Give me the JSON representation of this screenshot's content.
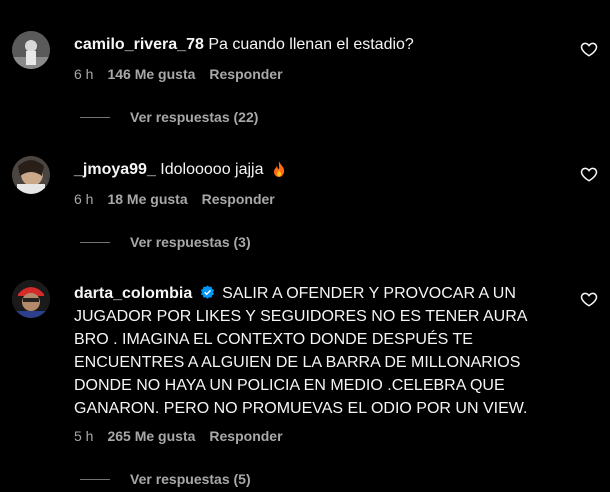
{
  "comments": [
    {
      "username": "camilo_rivera_78",
      "text": "Pa cuando llenan el estadio?",
      "time": "6 h",
      "likes": "146 Me gusta",
      "reply": "Responder",
      "view_replies": "Ver respuestas (22)"
    },
    {
      "username": "_jmoya99_",
      "text": "Idolooooo jajja",
      "time": "6 h",
      "likes": "18 Me gusta",
      "reply": "Responder",
      "view_replies": "Ver respuestas (3)"
    },
    {
      "username": "darta_colombia",
      "verified": true,
      "text": "SALIR A OFENDER Y PROVOCAR A UN JUGADOR POR LIKES Y SEGUIDORES NO ES TENER AURA BRO . IMAGINA EL CONTEXTO DONDE DESPUÉS TE ENCUENTRES A ALGUIEN DE LA BARRA DE MILLONARIOS DONDE NO HAYA UN POLICIA EN MEDIO .CELEBRA QUE GANARON. PERO NO PROMUEVAS EL ODIO POR UN VIEW.",
      "time": "5 h",
      "likes": "265 Me gusta",
      "reply": "Responder",
      "view_replies": "Ver respuestas (5)"
    }
  ],
  "colors": {
    "background": "#000000",
    "text": "#f5f5f5",
    "muted": "#a8a8a8",
    "verified": "#0095f6",
    "fire": "#ff6a13"
  },
  "icons": [
    "heart-outline-icon",
    "verified-badge-icon",
    "fire-emoji-icon"
  ]
}
